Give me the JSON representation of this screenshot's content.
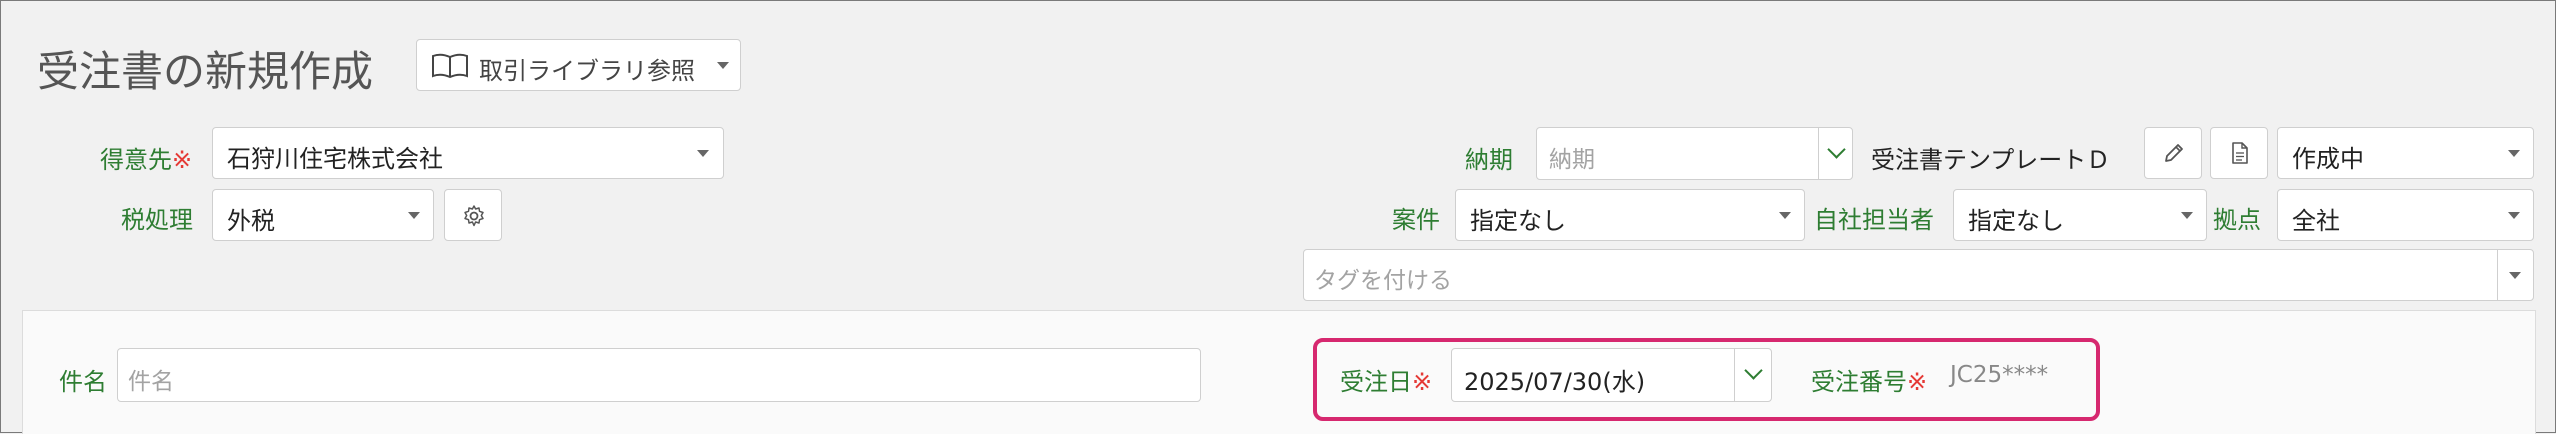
{
  "header": {
    "title": "受注書の新規作成",
    "library_button_label": "取引ライブラリ参照"
  },
  "customer": {
    "label": "得意先",
    "required_mark": "※",
    "value": "石狩川住宅株式会社"
  },
  "tax": {
    "label": "税処理",
    "value": "外税"
  },
  "delivery": {
    "label": "納期",
    "placeholder": "納期"
  },
  "template": {
    "name": "受注書テンプレートＤ"
  },
  "status": {
    "value": "作成中"
  },
  "project": {
    "label": "案件",
    "value": "指定なし"
  },
  "staff": {
    "label": "自社担当者",
    "value": "指定なし"
  },
  "branch": {
    "label": "拠点",
    "value": "全社"
  },
  "tags": {
    "placeholder": "タグを付ける"
  },
  "subject": {
    "label": "件名",
    "placeholder": "件名"
  },
  "order_date": {
    "label": "受注日",
    "required_mark": "※",
    "value": "2025/07/30(水)"
  },
  "order_number": {
    "label": "受注番号",
    "required_mark": "※",
    "value": "JC25****"
  },
  "colors": {
    "label_green": "#2e7d32",
    "required_red": "#e53935",
    "highlight_pink": "#d6286f"
  }
}
